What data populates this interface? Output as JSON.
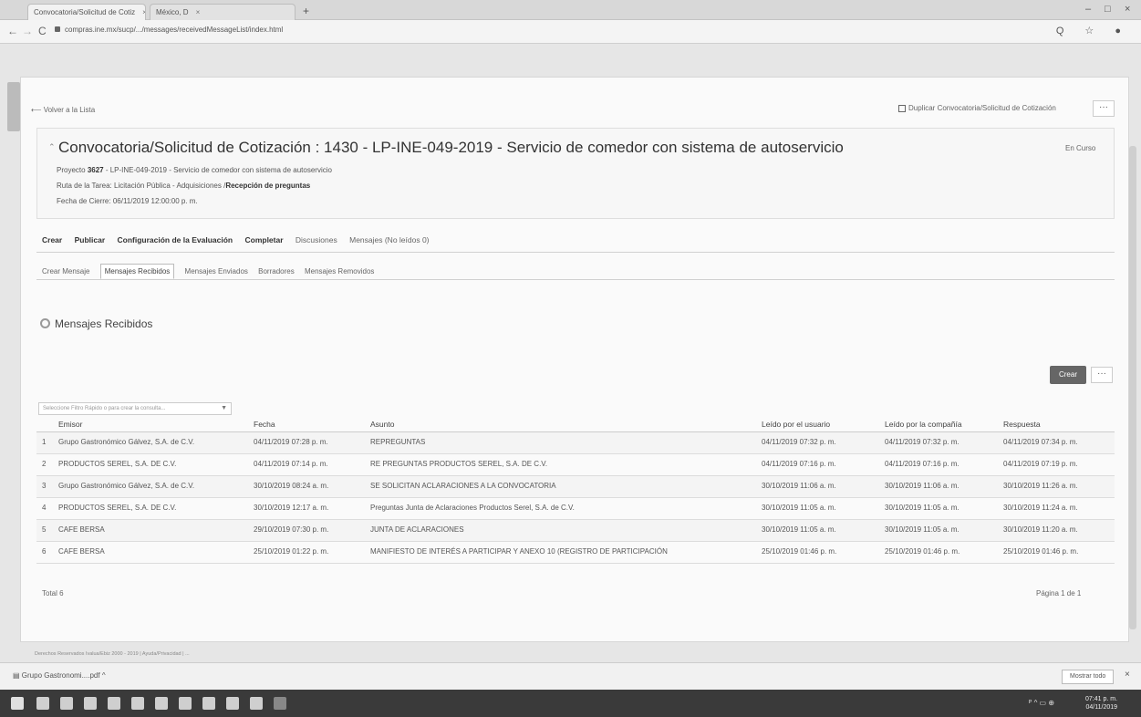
{
  "browser": {
    "tabs": [
      {
        "label": "Convocatoria/Solicitud de Cotiz",
        "close": "×"
      },
      {
        "label": "México, D",
        "close": "×"
      }
    ],
    "new_tab": "+",
    "window_controls": [
      "–",
      "□",
      "×"
    ],
    "nav": {
      "back": "←",
      "forward": "→",
      "reload": "C"
    },
    "url": "compras.ine.mx/sucp/.../messages/receivedMessageList/index.html",
    "addr_icons": "Q ☆ ●"
  },
  "page": {
    "back_link": "Volver a la Lista",
    "duplicate_link": "Duplicar Convocatoria/Solicitud de Cotización",
    "more": "···",
    "title": "Convocatoria/Solicitud de Cotización : 1430 - LP-INE-049-2019 - Servicio de comedor con sistema de autoservicio",
    "status": "En Curso",
    "meta": {
      "proyecto_label": "Proyecto",
      "proyecto_id": "3627",
      "proyecto_value": "- LP-INE-049-2019 - Servicio de comedor con sistema de autoservicio",
      "ruta_label": "Ruta de la Tarea:",
      "ruta_value": "Licitación Pública - Adquisiciones /",
      "ruta_bold": "Recepción de preguntas",
      "cierre_label": "Fecha de Cierre:",
      "cierre_value": "06/11/2019 12:00:00 p. m."
    },
    "main_tabs": [
      {
        "label": "Crear",
        "dim": false
      },
      {
        "label": "Publicar",
        "dim": false
      },
      {
        "label": "Configuración de la Evaluación",
        "dim": false
      },
      {
        "label": "Completar",
        "dim": false
      },
      {
        "label": "Discusiones",
        "dim": true
      },
      {
        "label": "Mensajes (No leídos 0)",
        "dim": true
      }
    ],
    "sub_tabs": [
      {
        "label": "Crear Mensaje",
        "active": false
      },
      {
        "label": "Mensajes Recibidos",
        "active": true
      },
      {
        "label": "Mensajes Enviados",
        "active": false
      },
      {
        "label": "Borradores",
        "active": false
      },
      {
        "label": "Mensajes Removidos",
        "active": false
      }
    ],
    "section_title": "Mensajes Recibidos",
    "create_button": "Crear",
    "filter_placeholder": "Seleccione Filtro Rápido o para crear la consulta...",
    "columns": [
      "Emisor",
      "Fecha",
      "Asunto",
      "Leído por el usuario",
      "Leído por la compañía",
      "Respuesta"
    ],
    "rows": [
      {
        "idx": "1",
        "emisor": "Grupo Gastronómico Gálvez, S.A. de C.V.",
        "fecha": "04/11/2019 07:28 p. m.",
        "asunto": "REPREGUNTAS",
        "leido_usuario": "04/11/2019 07:32 p. m.",
        "leido_compania": "04/11/2019 07:32 p. m.",
        "respuesta": "04/11/2019 07:34 p. m."
      },
      {
        "idx": "2",
        "emisor": "PRODUCTOS SEREL, S.A. DE C.V.",
        "fecha": "04/11/2019 07:14 p. m.",
        "asunto": "RE PREGUNTAS PRODUCTOS SEREL, S.A. DE C.V.",
        "leido_usuario": "04/11/2019 07:16 p. m.",
        "leido_compania": "04/11/2019 07:16 p. m.",
        "respuesta": "04/11/2019 07:19 p. m."
      },
      {
        "idx": "3",
        "emisor": "Grupo Gastronómico Gálvez, S.A. de C.V.",
        "fecha": "30/10/2019 08:24 a. m.",
        "asunto": "SE SOLICITAN ACLARACIONES A LA CONVOCATORIA",
        "leido_usuario": "30/10/2019 11:06 a. m.",
        "leido_compania": "30/10/2019 11:06 a. m.",
        "respuesta": "30/10/2019 11:26 a. m."
      },
      {
        "idx": "4",
        "emisor": "PRODUCTOS SEREL, S.A. DE C.V.",
        "fecha": "30/10/2019 12:17 a. m.",
        "asunto": "Preguntas Junta de Aclaraciones Productos Serel, S.A. de C.V.",
        "leido_usuario": "30/10/2019 11:05 a. m.",
        "leido_compania": "30/10/2019 11:05 a. m.",
        "respuesta": "30/10/2019 11:24 a. m."
      },
      {
        "idx": "5",
        "emisor": "CAFE BERSA",
        "fecha": "29/10/2019 07:30 p. m.",
        "asunto": "JUNTA DE ACLARACIONES",
        "leido_usuario": "30/10/2019 11:05 a. m.",
        "leido_compania": "30/10/2019 11:05 a. m.",
        "respuesta": "30/10/2019 11:20 a. m."
      },
      {
        "idx": "6",
        "emisor": "CAFE BERSA",
        "fecha": "25/10/2019 01:22 p. m.",
        "asunto": "MANIFIESTO DE INTERÉS A PARTICIPAR Y ANEXO 10 (REGISTRO DE PARTICIPACIÓN",
        "leido_usuario": "25/10/2019 01:46 p. m.",
        "leido_compania": "25/10/2019 01:46 p. m.",
        "respuesta": "25/10/2019 01:46 p. m."
      }
    ],
    "total": "Total 6",
    "pager": "Página 1 de 1",
    "footer": "Derechos Reservados Ivalua/Ebiz 2000 - 2019 | Ayuda/Privacidad | ..."
  },
  "downloads": {
    "item": "Grupo Gastronomi....pdf",
    "show_all": "Mostrar todo",
    "close": "×"
  },
  "taskbar": {
    "tray": "ᴾ ^ ▭ ⊕",
    "time": "07:41 p. m.",
    "date": "04/11/2019"
  }
}
